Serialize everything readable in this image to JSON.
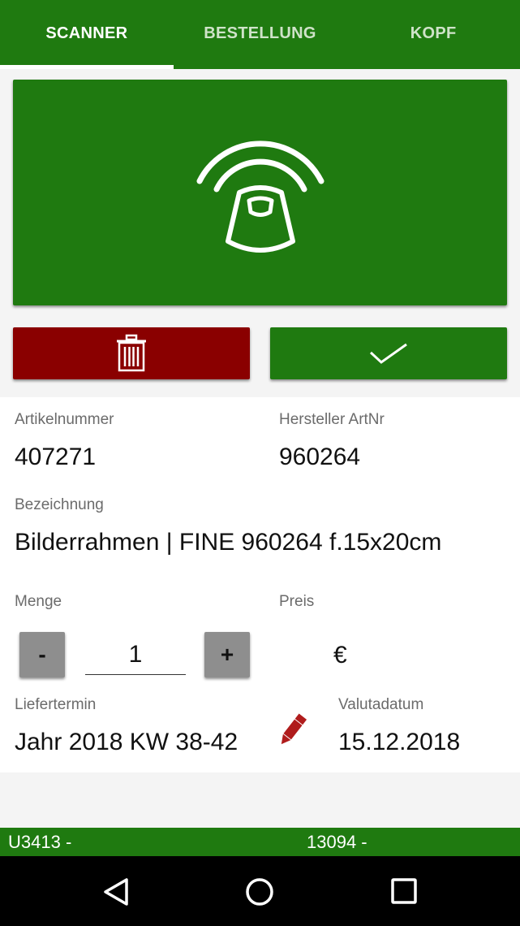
{
  "tabs": [
    {
      "label": "SCANNER",
      "active": true
    },
    {
      "label": "BESTELLUNG",
      "active": false
    },
    {
      "label": "KOPF",
      "active": false
    }
  ],
  "colors": {
    "primary": "#1f7a10",
    "danger": "#8a0000",
    "icon_edit": "#b01c1c"
  },
  "icons": {
    "scan": "scanner-icon",
    "delete": "trash-icon",
    "confirm": "check-icon",
    "edit": "pencil-icon"
  },
  "fields": {
    "artikelnummer": {
      "label": "Artikelnummer",
      "value": "407271"
    },
    "hersteller": {
      "label": "Hersteller ArtNr",
      "value": "960264"
    },
    "bezeichnung": {
      "label": "Bezeichnung",
      "value": "Bilderrahmen | FINE 960264 f.15x20cm"
    },
    "menge": {
      "label": "Menge",
      "value": "1",
      "minus": "-",
      "plus": "+"
    },
    "preis": {
      "label": "Preis",
      "value": "€"
    },
    "liefertermin": {
      "label": "Liefertermin",
      "value": "Jahr 2018 KW 38-42"
    },
    "valutadatum": {
      "label": "Valutadatum",
      "value": "15.12.2018"
    }
  },
  "footer": {
    "left": "U3413 -",
    "right": "13094 -"
  }
}
